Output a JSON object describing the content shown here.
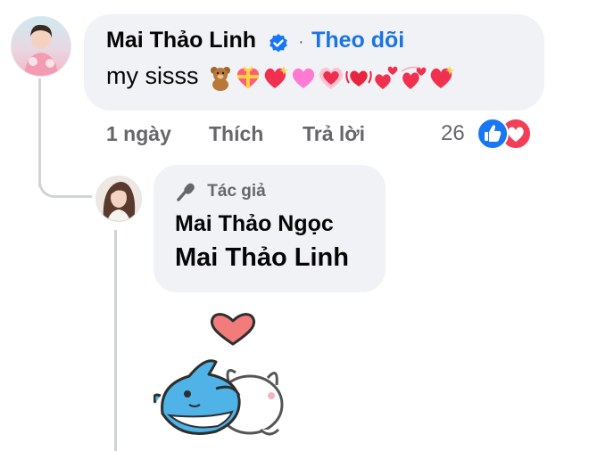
{
  "comment": {
    "author": "Mai Thảo Linh",
    "separator": "·",
    "follow_label": "Theo dõi",
    "text": "my sisss",
    "emojis": [
      "teddy-bear",
      "heart-with-ribbon",
      "sparkling-heart",
      "pink-heart",
      "growing-heart",
      "beating-heart",
      "two-hearts",
      "revolving-hearts",
      "sparkling-heart"
    ],
    "time": "1 ngày",
    "like_label": "Thích",
    "reply_label": "Trả lời",
    "reaction_count": "26",
    "reactions": [
      "like",
      "love"
    ]
  },
  "reply": {
    "badge_label": "Tác giả",
    "author": "Mai Thảo Ngọc",
    "mention": "Mai Thảo Linh",
    "sticker": "shark-hugging-cat-with-heart"
  },
  "colors": {
    "bubble": "#f0f2f5",
    "link_blue": "#1b74e4",
    "meta_gray": "#65676b",
    "like_blue": "#1877f2",
    "love_red": "#f33e58",
    "thread_line": "#d0d3d8"
  }
}
